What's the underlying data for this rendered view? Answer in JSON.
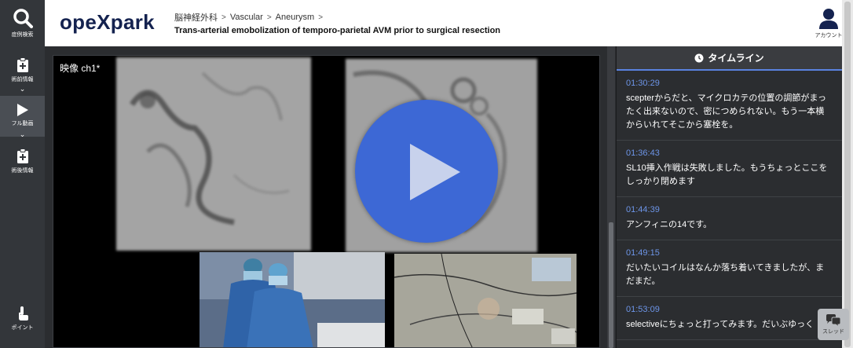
{
  "app": {
    "logo": "opeXpark"
  },
  "sidebar": {
    "items": [
      {
        "label": "症例検索",
        "icon": "search-icon"
      },
      {
        "label": "術前情報",
        "icon": "clipboard-plus-icon"
      },
      {
        "label": "フル動画",
        "icon": "play-icon"
      },
      {
        "label": "術後情報",
        "icon": "clipboard-plus-icon"
      }
    ],
    "bottom": {
      "label": "ポイント",
      "icon": "hand-pointer-icon"
    }
  },
  "header": {
    "breadcrumbs": [
      "脳神経外科",
      "Vascular",
      "Aneurysm"
    ],
    "title": "Trans-arterial emobolization of temporo-parietal AVM prior to surgical resection",
    "account_label": "アカウント"
  },
  "player": {
    "channel_label": "映像 ch1*"
  },
  "timeline": {
    "title": "タイムライン",
    "entries": [
      {
        "time": "01:30:29",
        "text": "scepterからだと、マイクロカテの位置の調節がまったく出来ないので、密につめられない。もう一本横からいれてそこから塞栓を。"
      },
      {
        "time": "01:36:43",
        "text": "SL10挿入作戦は失敗しました。もうちょっとここをしっかり閉めます"
      },
      {
        "time": "01:44:39",
        "text": "アンフィニの14です。"
      },
      {
        "time": "01:49:15",
        "text": "だいたいコイルはなんか落ち着いてきましたが、まだまだ。"
      },
      {
        "time": "01:53:09",
        "text": "selectiveにちょっと打ってみます。だいぶゆっく"
      }
    ]
  },
  "thread_button": {
    "label": "スレッド"
  },
  "colors": {
    "accent": "#3d68d5",
    "brand": "#14224f",
    "time": "#6d95e8"
  }
}
